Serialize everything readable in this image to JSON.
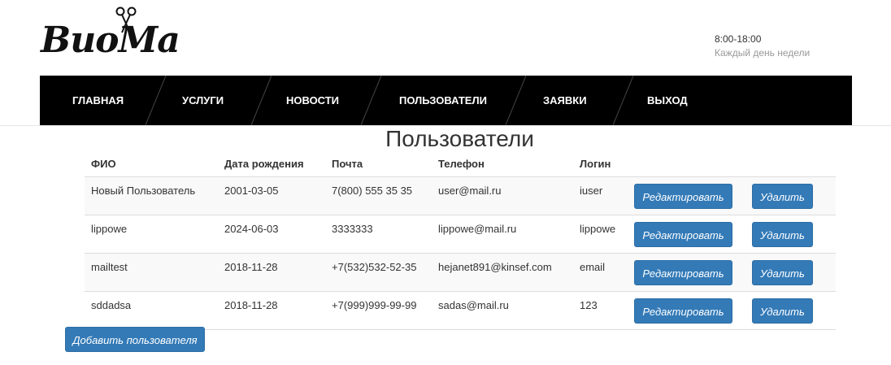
{
  "brand": {
    "logo_text": "ВиоМа"
  },
  "hours": {
    "time": "8:00-18:00",
    "days": "Каждый день недели"
  },
  "nav": [
    {
      "label": "Главная"
    },
    {
      "label": "Услуги"
    },
    {
      "label": "Новости"
    },
    {
      "label": "Пользователи"
    },
    {
      "label": "Заявки"
    },
    {
      "label": "Выход"
    }
  ],
  "page": {
    "title": "Пользователи"
  },
  "table": {
    "headers": [
      "ФИО",
      "Дата рождения",
      "Почта",
      "Телефон",
      "Логин"
    ],
    "rows": [
      [
        "Новый Пользователь",
        "2001-03-05",
        "7(800) 555 35 35",
        "user@mail.ru",
        "iuser"
      ],
      [
        "lippowe",
        "2024-06-03",
        "3333333",
        "lippowe@mail.ru",
        "lippowe"
      ],
      [
        "mailtest",
        "2018-11-28",
        "+7(532)532-52-35",
        "hejanet891@kinsef.com",
        "email"
      ],
      [
        "sddadsa",
        "2018-11-28",
        "+7(999)999-99-99",
        "sadas@mail.ru",
        "123"
      ]
    ],
    "edit_label": "Редактировать",
    "delete_label": "Удалить"
  },
  "add_user_label": "Добавить пользователя",
  "colors": {
    "navbar": "#000000",
    "button": "#337ab7",
    "row_stripe": "#f9f9f9"
  }
}
